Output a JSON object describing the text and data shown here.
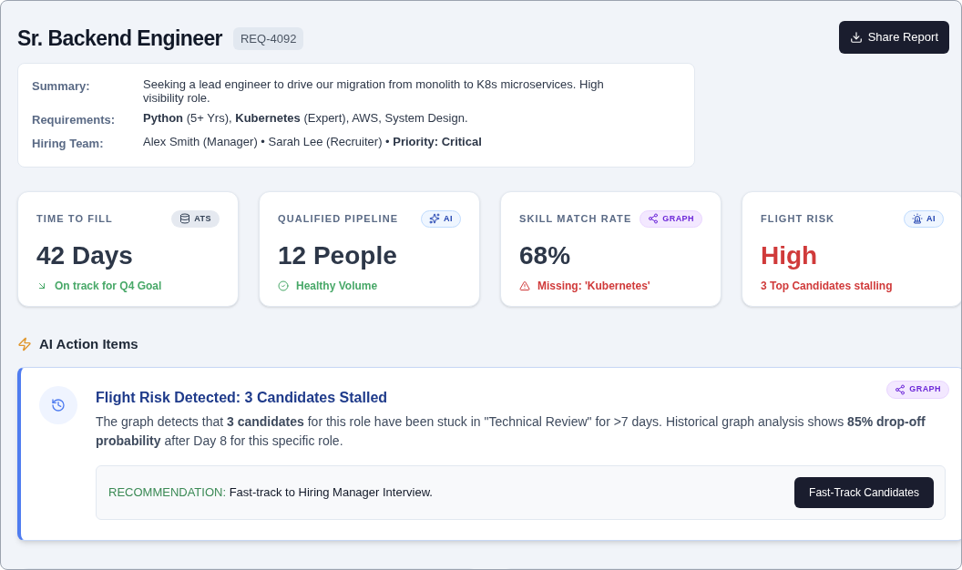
{
  "header": {
    "title": "Sr. Backend Engineer",
    "req_id": "REQ-4092",
    "share_button": "Share Report"
  },
  "details": [
    {
      "label": "Summary:",
      "value": "Seeking a lead engineer to drive our migration from monolith to K8s microservices. High visibility role."
    },
    {
      "label": "Requirements:",
      "value": "**Python** (5+ Yrs), **Kubernetes** (Expert), AWS, System Design."
    },
    {
      "label": "Hiring Team:",
      "value": "Alex Smith (Manager) • Sarah Lee (Recruiter) • **Priority: Critical**"
    }
  ],
  "metrics": [
    {
      "label": "TIME TO FILL",
      "badge": {
        "kind": "ats",
        "text": "ATS"
      },
      "value": "42 Days",
      "kind": "trend",
      "note": "On track for Q4 Goal"
    },
    {
      "label": "QUALIFIED PIPELINE",
      "badge": {
        "kind": "ai",
        "text": "AI"
      },
      "value": "12 People",
      "kind": "healthy",
      "note": "Healthy Volume"
    },
    {
      "label": "SKILL MATCH RATE",
      "badge": {
        "kind": "graph",
        "text": "GRAPH"
      },
      "value": "68%",
      "kind": "warning",
      "note": "Missing: 'Kubernetes'"
    },
    {
      "label": "FLIGHT RISK",
      "badge": {
        "kind": "ai-alert",
        "text": "AI"
      },
      "value": "High",
      "kind": "alert",
      "note": "3 Top Candidates stalling"
    }
  ],
  "action_items": {
    "heading": "AI Action Items",
    "items": [
      {
        "title": "Flight Risk Detected: 3 Candidates Stalled",
        "badge": {
          "kind": "graph",
          "text": "GRAPH"
        },
        "body": "The graph detects that **3 candidates** for this role have been stuck in \"Technical Review\" for >7 days. Historical graph analysis shows **85% drop-off probability** after Day 8 for this specific role.",
        "recommendation_label": "RECOMMENDATION:",
        "recommendation": "Fast-track to Hiring Manager Interview.",
        "action_button": "Fast-Track Candidates"
      }
    ]
  }
}
